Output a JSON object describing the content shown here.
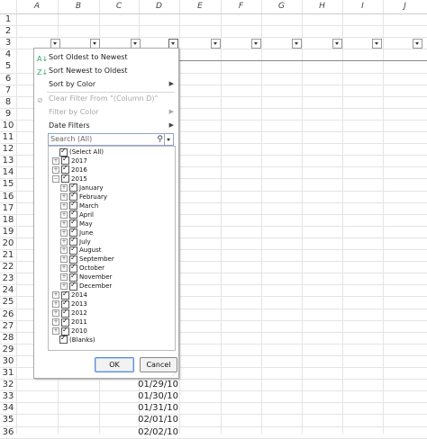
{
  "columns": [
    "A",
    "B",
    "C",
    "D",
    "E",
    "F",
    "G",
    "H",
    "I",
    "J"
  ],
  "rows": [
    "1",
    "2",
    "3",
    "4",
    "5",
    "6",
    "7",
    "8",
    "9",
    "10",
    "11",
    "12",
    "13",
    "14",
    "15",
    "16",
    "17",
    "18",
    "19",
    "20",
    "21",
    "22",
    "23",
    "24",
    "25",
    "26",
    "27",
    "28",
    "29",
    "30",
    "31",
    "32",
    "33",
    "34",
    "35",
    "36"
  ],
  "cells": [
    {
      "row": "32",
      "value": "01/29/10"
    },
    {
      "row": "33",
      "value": "01/30/10"
    },
    {
      "row": "34",
      "value": "01/31/10"
    },
    {
      "row": "35",
      "value": "02/01/10"
    },
    {
      "row": "36",
      "value": "02/02/10"
    }
  ],
  "menu": {
    "sort_oldest": "Sort Oldest to Newest",
    "sort_newest": "Sort Newest to Oldest",
    "sort_color": "Sort by Color",
    "clear_filter": "Clear Filter From \"(Column D)\"",
    "filter_color": "Filter by Color",
    "date_filters": "Date Filters",
    "search_placeholder": "Search (All)",
    "ok": "OK",
    "cancel": "Cancel"
  },
  "tree": [
    {
      "label": "(Select All)",
      "level": 0,
      "exp": ""
    },
    {
      "label": "2017",
      "level": 0,
      "exp": "+"
    },
    {
      "label": "2016",
      "level": 0,
      "exp": "+"
    },
    {
      "label": "2015",
      "level": 0,
      "exp": "−"
    },
    {
      "label": "January",
      "level": 1,
      "exp": "+"
    },
    {
      "label": "February",
      "level": 1,
      "exp": "+"
    },
    {
      "label": "March",
      "level": 1,
      "exp": "+"
    },
    {
      "label": "April",
      "level": 1,
      "exp": "+"
    },
    {
      "label": "May",
      "level": 1,
      "exp": "+"
    },
    {
      "label": "June",
      "level": 1,
      "exp": "+"
    },
    {
      "label": "July",
      "level": 1,
      "exp": "+"
    },
    {
      "label": "August",
      "level": 1,
      "exp": "+"
    },
    {
      "label": "September",
      "level": 1,
      "exp": "+"
    },
    {
      "label": "October",
      "level": 1,
      "exp": "+"
    },
    {
      "label": "November",
      "level": 1,
      "exp": "+"
    },
    {
      "label": "December",
      "level": 1,
      "exp": "+"
    },
    {
      "label": "2014",
      "level": 0,
      "exp": "+"
    },
    {
      "label": "2013",
      "level": 0,
      "exp": "+"
    },
    {
      "label": "2012",
      "level": 0,
      "exp": "+"
    },
    {
      "label": "2011",
      "level": 0,
      "exp": "+"
    },
    {
      "label": "2010",
      "level": 0,
      "exp": "+"
    },
    {
      "label": "(Blanks)",
      "level": 0,
      "exp": ""
    }
  ]
}
